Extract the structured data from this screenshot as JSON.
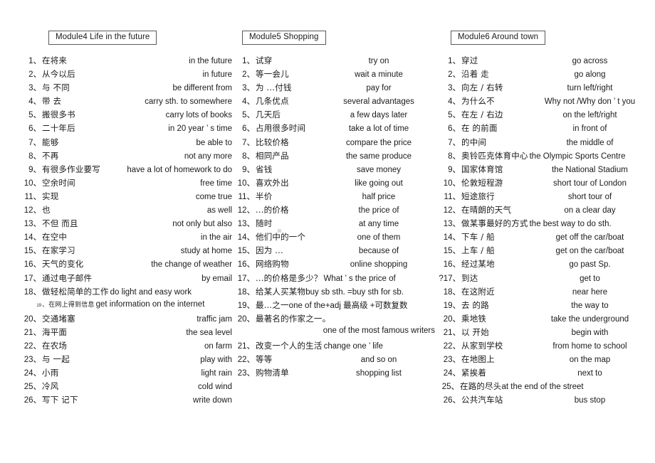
{
  "document": {
    "title": "Module4-6 English-Chinese Phrase List",
    "background_color": "#ffffff",
    "text_color": "#1a1a1a"
  },
  "columns": [
    {
      "id": "module4",
      "heading": "Module4 Life in the future",
      "entries": [
        {
          "num": "1、",
          "cn": "在将来",
          "en": "in the future"
        },
        {
          "num": "2、",
          "cn": "从今以后",
          "en": "in  future"
        },
        {
          "num": "3、",
          "cn": "与  不同",
          "en": "be different from"
        },
        {
          "num": "4、",
          "cn": "带 去",
          "en": "carry sth. to somewhere"
        },
        {
          "num": "5、",
          "cn": "搬很多书",
          "en": "carry lots of books"
        },
        {
          "num": "6、",
          "cn": "二十年后",
          "en": "in 20 year ’ s time"
        },
        {
          "num": "7、",
          "cn": "能够",
          "en": "be able to"
        },
        {
          "num": "8、",
          "cn": "不再",
          "en": "not   any more"
        },
        {
          "num": "9、",
          "cn": "有很多作业要写",
          "en": "have a lot of homework to do"
        },
        {
          "num": "10、",
          "cn": "空余时间",
          "en": "free time"
        },
        {
          "num": "11、",
          "cn": "实现",
          "en": "come true"
        },
        {
          "num": "12、",
          "cn": "也",
          "en": "as well"
        },
        {
          "num": "13、",
          "cn": "不但   而且",
          "en": "not only   but also"
        },
        {
          "num": "14、",
          "cn": "在空中",
          "en": "in the air"
        },
        {
          "num": "15、",
          "cn": "在家学习",
          "en": "study at home"
        },
        {
          "num": "16、",
          "cn": "天气的变化",
          "en": "the change of weather"
        },
        {
          "num": "17、",
          "cn": " 通过电子邮件",
          "en": "by email"
        },
        {
          "num": "18、",
          "cn": "做轻松简单的工作",
          "en": "do light and easy work",
          "style": "wide"
        },
        {
          "num": "19",
          "cn": "、在网上得到信息",
          "en": "get information on the internet",
          "style": "tiny wide"
        },
        {
          "num": "20、",
          "cn": "交通堵塞",
          "en": "traffic   jam"
        },
        {
          "num": "21、",
          "cn": "海平面",
          "en": "the sea level"
        },
        {
          "num": "22、",
          "cn": "在农场",
          "en": "on farm"
        },
        {
          "num": "23、",
          "cn": "与  一起",
          "en": "play with"
        },
        {
          "num": "24、",
          "cn": "小雨",
          "en": "light rain"
        },
        {
          "num": "25、",
          "cn": "冷风",
          "en": "cold  wind"
        },
        {
          "num": "26、",
          "cn": "写下   记下",
          "en": "write down"
        }
      ]
    },
    {
      "id": "module5",
      "heading": "Module5 Shopping",
      "entries": [
        {
          "num": "1、",
          "cn": "试穿",
          "en": "try on"
        },
        {
          "num": "2、",
          "cn": "等一会儿",
          "en": "wait a minute"
        },
        {
          "num": "3、",
          "cn": "为 ...付钱",
          "en": "pay for"
        },
        {
          "num": "4、",
          "cn": "几条优点",
          "en": "several advantages"
        },
        {
          "num": "5、",
          "cn": " 几天后",
          "en": "a few days later"
        },
        {
          "num": "6、",
          "cn": "占用很多时间",
          "en": "take a lot of time"
        },
        {
          "num": "7、",
          "cn": "比较价格",
          "en": "compare the price"
        },
        {
          "num": "8、",
          "cn": "相同产品",
          "en": "the   same produce"
        },
        {
          "num": "9、",
          "cn": "省钱",
          "en": "save money"
        },
        {
          "num": "10、",
          "cn": "喜欢外出",
          "en": "like  going  out"
        },
        {
          "num": "11、",
          "cn": "半价",
          "en": "half price"
        },
        {
          "num": "12、",
          "cn": "   ...的价格",
          "en": "the price of"
        },
        {
          "num": "13、",
          "cn": "随时",
          "en": "at any time"
        },
        {
          "num": "14、",
          "cn": "他们中的一个",
          "en": "one of them"
        },
        {
          "num": "15、",
          "cn": "因为 ...",
          "en": "because of"
        },
        {
          "num": "16、",
          "cn": " 网络购物",
          "en": "online shopping"
        },
        {
          "num": "17、",
          "cn": "...的价格是多少？",
          "en": "What ’ s the price of",
          "style": "wide"
        },
        {
          "num": "18、",
          "cn": "给某人买某物",
          "en": "buy sb sth. =buy sth for sb.",
          "style": "full"
        },
        {
          "num": "19、",
          "cn": "最...之一",
          "en": "one of the+adj 最高级 +可数复数",
          "style": "full"
        },
        {
          "num": "20、",
          "cn": "最著名的作家之一。",
          "en": "",
          "style": "full"
        },
        {
          "num": "",
          "cn": "",
          "en": "one of the most famous writers",
          "style": "cont"
        },
        {
          "num": "21、",
          "cn": "改变一个人的生活",
          "en": "change one ’ life",
          "style": "wide"
        },
        {
          "num": "22、",
          "cn": "等等",
          "en": "and so on"
        },
        {
          "num": "23、",
          "cn": "购物清单",
          "en": "shopping list"
        }
      ]
    },
    {
      "id": "module6",
      "heading": "Module6 Around town",
      "entries": [
        {
          "num": "1、",
          "cn": "穿过",
          "en": "go across"
        },
        {
          "num": "2、",
          "cn": "沿着   走",
          "en": "go along"
        },
        {
          "num": "3、",
          "cn": "向左 / 右转",
          "en": "turn left/right"
        },
        {
          "num": "4、",
          "cn": "为什么不",
          "en": "Why not /Why don ’ t  you"
        },
        {
          "num": "5、",
          "cn": "在左 / 右边",
          "en": "on the left/right"
        },
        {
          "num": "6、",
          "cn": "在  的前面",
          "en": "in front of"
        },
        {
          "num": "7、",
          "cn": " 的中间",
          "en": "the middle of"
        },
        {
          "num": "8、",
          "cn": "奥铃匹克体育中心",
          "en": "the Olympic Sports Centre",
          "style": "wide"
        },
        {
          "num": "9、",
          "cn": "国家体育馆",
          "en": "the National Stadium"
        },
        {
          "num": "10、",
          "cn": "伦敦短程游",
          "en": "short tour of London"
        },
        {
          "num": "11、",
          "cn": "短途旅行",
          "en": "short tour of"
        },
        {
          "num": "12、",
          "cn": "在晴朗的天气",
          "en": "on a clear day"
        },
        {
          "num": "13、",
          "cn": "做某事最好的方式",
          "en": "the best way to do sth.",
          "style": "wide"
        },
        {
          "num": "14、",
          "cn": "下车 / 船",
          "en": "get off the car/boat"
        },
        {
          "num": "15、",
          "cn": "上车 / 船",
          "en": "get on the car/boat"
        },
        {
          "num": "16、",
          "cn": "经过某地",
          "en": "go past Sp."
        },
        {
          "num": "?17、",
          "cn": "到达",
          "en": "get to"
        },
        {
          "num": "18、",
          "cn": "  在这附近",
          "en": "near here"
        },
        {
          "num": "19、",
          "cn": "  去   的路",
          "en": "the way to"
        },
        {
          "num": "20、",
          "cn": "乘地铁",
          "en": "take the underground"
        },
        {
          "num": "21、",
          "cn": "  以   开始",
          "en": "begin with"
        },
        {
          "num": "22、",
          "cn": " 从家到学校",
          "en": "from home to school"
        },
        {
          "num": "23、",
          "cn": " 在地图上",
          "en": "on the map"
        },
        {
          "num": "24、",
          "cn": "紧挨着",
          "en": "next to"
        },
        {
          "num": "25、",
          "cn": "在路的尽头",
          "en": "at the end of the street",
          "style": "full"
        },
        {
          "num": "26、",
          "cn": "公共汽车站",
          "en": "bus stop"
        }
      ]
    }
  ]
}
